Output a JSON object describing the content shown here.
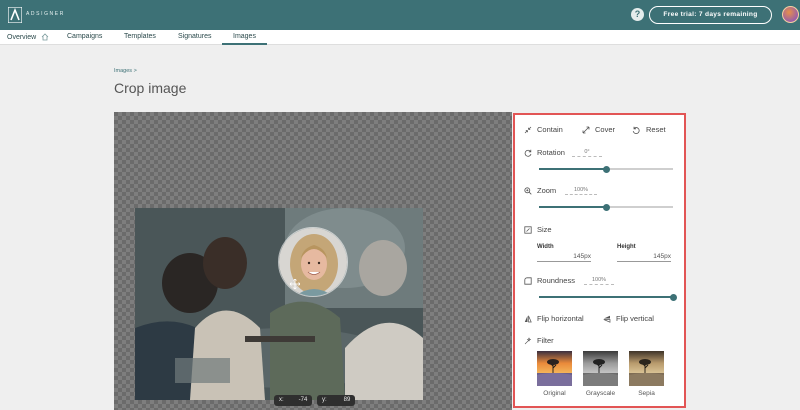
{
  "header": {
    "brand": "ADSIGNER",
    "help_icon": "question-icon",
    "trial_label": "Free trial: 7 days remaining"
  },
  "nav": {
    "items": [
      {
        "label": "Overview"
      },
      {
        "label": "Campaigns"
      },
      {
        "label": "Templates"
      },
      {
        "label": "Signatures"
      },
      {
        "label": "Images"
      }
    ],
    "active": "Images"
  },
  "page": {
    "breadcrumb": "Images >",
    "title": "Crop image"
  },
  "canvas": {
    "x_label": "x:",
    "x_value": "-74",
    "y_label": "y:",
    "y_value": "89"
  },
  "panel": {
    "fit": {
      "contain": "Contain",
      "cover": "Cover",
      "reset": "Reset"
    },
    "rotation": {
      "label": "Rotation",
      "value": "0°",
      "level": 0.5
    },
    "zoom": {
      "label": "Zoom",
      "value": "100%",
      "level": 0.5
    },
    "size": {
      "label": "Size",
      "width_label": "Width",
      "width_value": "145px",
      "height_label": "Height",
      "height_value": "145px"
    },
    "roundness": {
      "label": "Roundness",
      "value": "100%",
      "level": 1.0
    },
    "flip": {
      "horizontal": "Flip horizontal",
      "vertical": "Flip vertical"
    },
    "filter": {
      "label": "Filter",
      "options": [
        "Original",
        "Grayscale",
        "Sepia"
      ]
    }
  },
  "colors": {
    "brand": "#3d7176",
    "highlight": "#e25555"
  }
}
